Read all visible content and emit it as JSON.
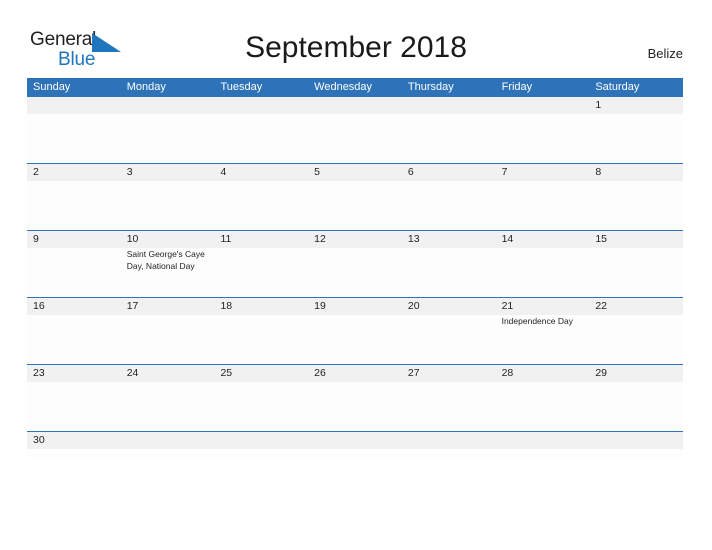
{
  "brand": {
    "word_one": "General",
    "word_two": "Blue",
    "triangle_color": "#1f76bc",
    "word_one_color": "#231f20",
    "word_two_color": "#1f76bc"
  },
  "header": {
    "title": "September 2018",
    "region": "Belize"
  },
  "theme": {
    "header_blue": "#2e72b8",
    "band_gray": "#f1f1f1",
    "cell_white": "#fdfdfd",
    "text": "#231f20"
  },
  "calendar": {
    "weekday_headers": [
      "Sunday",
      "Monday",
      "Tuesday",
      "Wednesday",
      "Thursday",
      "Friday",
      "Saturday"
    ],
    "weeks": [
      {
        "days": [
          {
            "num": "",
            "event": ""
          },
          {
            "num": "",
            "event": ""
          },
          {
            "num": "",
            "event": ""
          },
          {
            "num": "",
            "event": ""
          },
          {
            "num": "",
            "event": ""
          },
          {
            "num": "",
            "event": ""
          },
          {
            "num": "1",
            "event": ""
          }
        ]
      },
      {
        "days": [
          {
            "num": "2",
            "event": ""
          },
          {
            "num": "3",
            "event": ""
          },
          {
            "num": "4",
            "event": ""
          },
          {
            "num": "5",
            "event": ""
          },
          {
            "num": "6",
            "event": ""
          },
          {
            "num": "7",
            "event": ""
          },
          {
            "num": "8",
            "event": ""
          }
        ]
      },
      {
        "days": [
          {
            "num": "9",
            "event": ""
          },
          {
            "num": "10",
            "event": "Saint George's Caye Day, National Day"
          },
          {
            "num": "11",
            "event": ""
          },
          {
            "num": "12",
            "event": ""
          },
          {
            "num": "13",
            "event": ""
          },
          {
            "num": "14",
            "event": ""
          },
          {
            "num": "15",
            "event": ""
          }
        ]
      },
      {
        "days": [
          {
            "num": "16",
            "event": ""
          },
          {
            "num": "17",
            "event": ""
          },
          {
            "num": "18",
            "event": ""
          },
          {
            "num": "19",
            "event": ""
          },
          {
            "num": "20",
            "event": ""
          },
          {
            "num": "21",
            "event": "Independence Day"
          },
          {
            "num": "22",
            "event": ""
          }
        ]
      },
      {
        "days": [
          {
            "num": "23",
            "event": ""
          },
          {
            "num": "24",
            "event": ""
          },
          {
            "num": "25",
            "event": ""
          },
          {
            "num": "26",
            "event": ""
          },
          {
            "num": "27",
            "event": ""
          },
          {
            "num": "28",
            "event": ""
          },
          {
            "num": "29",
            "event": ""
          }
        ]
      },
      {
        "days": [
          {
            "num": "30",
            "event": ""
          },
          {
            "num": "",
            "event": ""
          },
          {
            "num": "",
            "event": ""
          },
          {
            "num": "",
            "event": ""
          },
          {
            "num": "",
            "event": ""
          },
          {
            "num": "",
            "event": ""
          },
          {
            "num": "",
            "event": ""
          }
        ]
      }
    ]
  }
}
